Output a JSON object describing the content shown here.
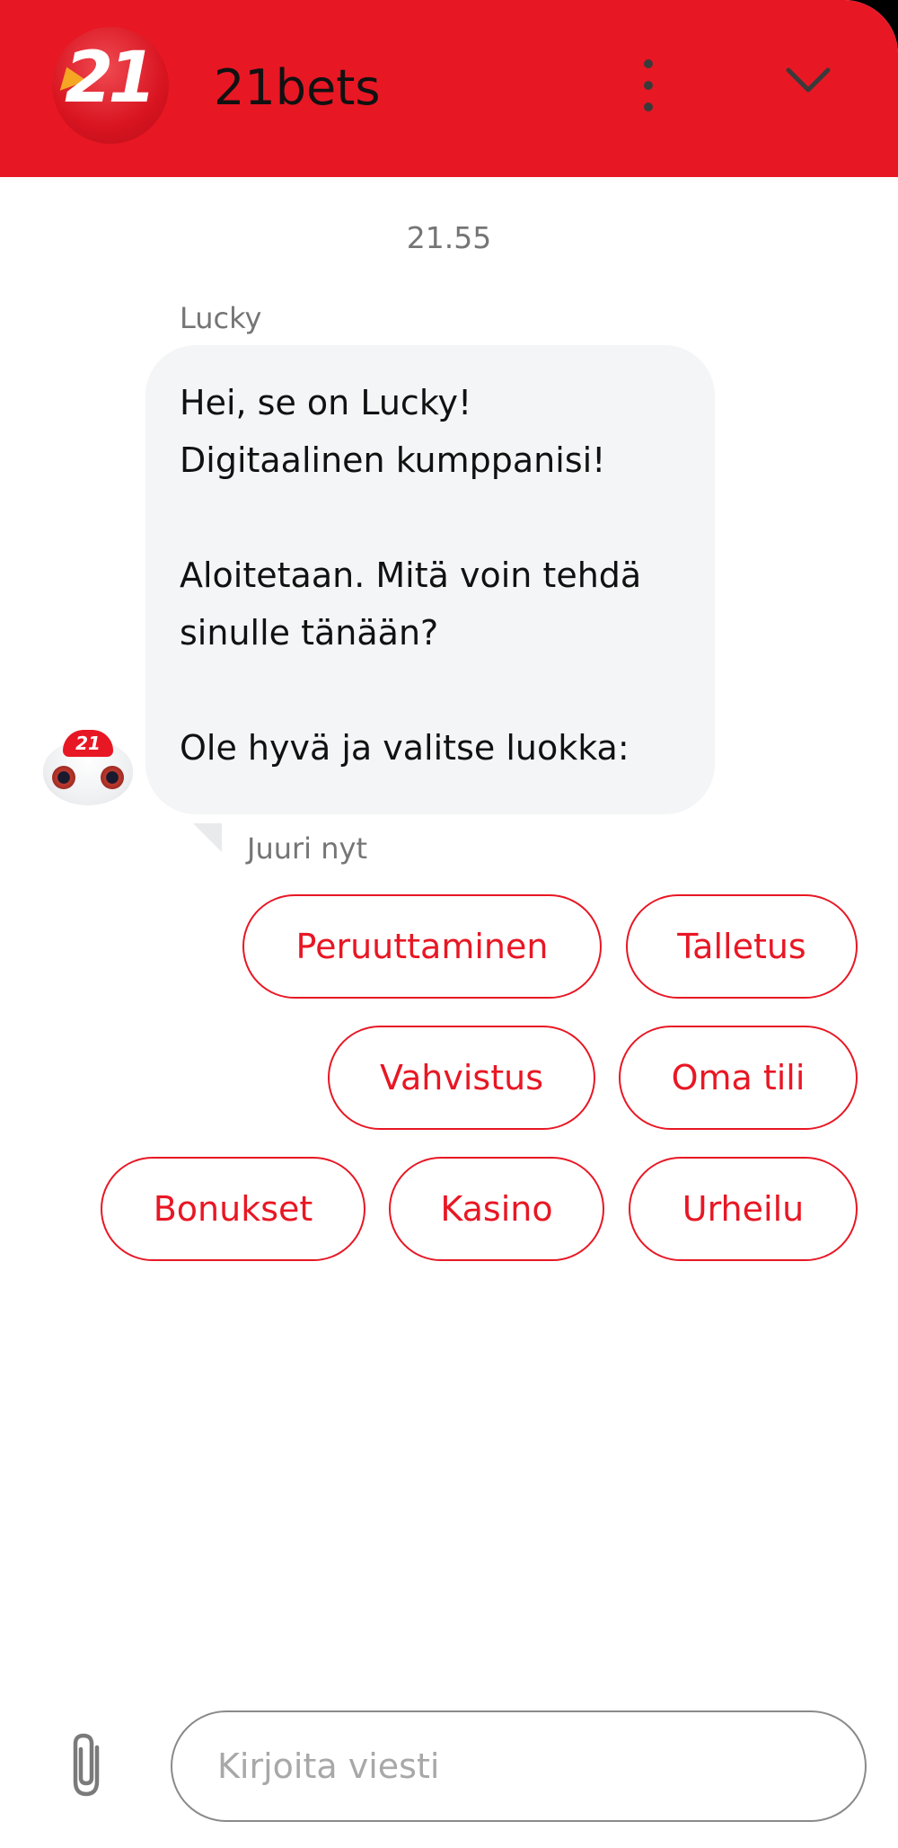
{
  "header": {
    "logo_text": "21",
    "title": "21bets",
    "more_icon": "more-vertical-icon",
    "collapse_icon": "chevron-down-icon"
  },
  "chat": {
    "timestamp": "21.55",
    "message": {
      "sender": "Lucky",
      "lines": [
        "Hei, se on Lucky!",
        "Digitaalinen kumppanisi!",
        "",
        "Aloitetaan. Mitä voin tehdä",
        "sinulle tänään?",
        "",
        "Ole hyvä ja valitse luokka:"
      ],
      "status": "Juuri nyt",
      "avatar_cap": "21"
    },
    "quick_replies": [
      "Peruuttaminen",
      "Talletus",
      "Vahvistus",
      "Oma tili",
      "Bonukset",
      "Kasino",
      "Urheilu"
    ]
  },
  "composer": {
    "placeholder": "Kirjoita viesti",
    "value": "",
    "attach_icon": "paperclip-icon"
  },
  "colors": {
    "brand_red": "#e81724",
    "bubble_bg": "#f3f5f6",
    "muted_text": "#757575"
  }
}
